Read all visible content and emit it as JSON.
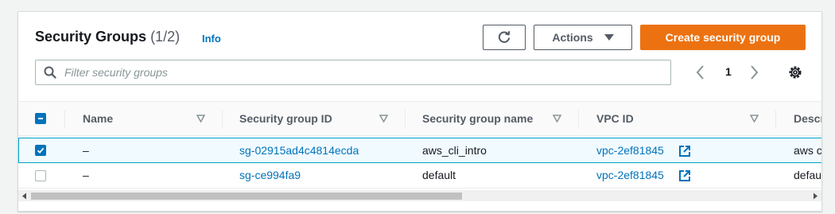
{
  "header": {
    "title": "Security Groups",
    "count": "(1/2)",
    "info_label": "Info"
  },
  "toolbar": {
    "actions_label": "Actions",
    "create_label": "Create security group"
  },
  "search": {
    "placeholder": "Filter security groups"
  },
  "pagination": {
    "current_page": "1"
  },
  "table": {
    "columns": [
      "Name",
      "Security group ID",
      "Security group name",
      "VPC ID",
      "Descr"
    ],
    "rows": [
      {
        "selected": true,
        "name": "–",
        "sg_id": "sg-02915ad4c4814ecda",
        "sg_name": "aws_cli_intro",
        "vpc_id": "vpc-2ef81845",
        "description": "aws c"
      },
      {
        "selected": false,
        "name": "–",
        "sg_id": "sg-ce994fa9",
        "sg_name": "default",
        "vpc_id": "vpc-2ef81845",
        "description": "defau"
      }
    ]
  },
  "colors": {
    "accent": "#ec7211",
    "link": "#0073bb",
    "selected_row": "#f1faff",
    "selected_border": "#00a1c9"
  },
  "icons": [
    "refresh-icon",
    "caret-down-icon",
    "search-icon",
    "chevron-left-icon",
    "chevron-right-icon",
    "settings-icon",
    "sort-icon",
    "external-link-icon",
    "checkbox-indeterminate-icon",
    "checkbox-checked-icon"
  ]
}
